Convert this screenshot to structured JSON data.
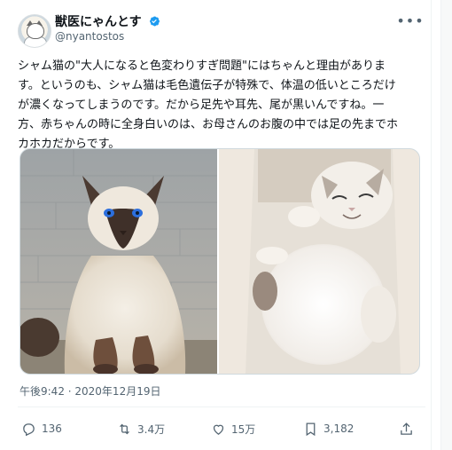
{
  "author": {
    "name": "獣医にゃんとす",
    "handle": "@nyantostos",
    "verified": true,
    "verified_color": "#1d9bf0"
  },
  "tweet": {
    "text": "シャム猫の\"大人になると色変わりすぎ問題\"にはちゃんと理由がありま す。というのも、シャム猫は毛色遺伝子が特殊で、体温の低いところだけ が濃くなってしまうのです。だから足先や耳先、尾が黒いんですね。一 方、赤ちゃんの時に全身白いのは、お母さんのお腹の中では足の先までホ カホカだからです。",
    "lines": [
      "シャム猫の\"大人になると色変わりすぎ問題\"にはちゃんと理由がありま",
      "す。というのも、シャム猫は毛色遺伝子が特殊で、体温の低いところだけ",
      "が濃くなってしまうのです。だから足先や耳先、尾が黒いんですね。一",
      "方、赤ちゃんの時に全身白いのは、お母さんのお腹の中では足の先までホ",
      "カホカだからです。"
    ],
    "timestamp": "午後9:42 · 2020年12月19日"
  },
  "media": [
    {
      "description": "adult-siamese-cat-photo"
    },
    {
      "description": "white-kitten-sleeping-photo"
    }
  ],
  "actions": {
    "reply_count": "136",
    "retweet_count": "3.4万",
    "like_count": "15万",
    "bookmark_count": "3,182"
  },
  "colors": {
    "text": "#0f1419",
    "secondary": "#536471",
    "border": "#cfd9de"
  }
}
